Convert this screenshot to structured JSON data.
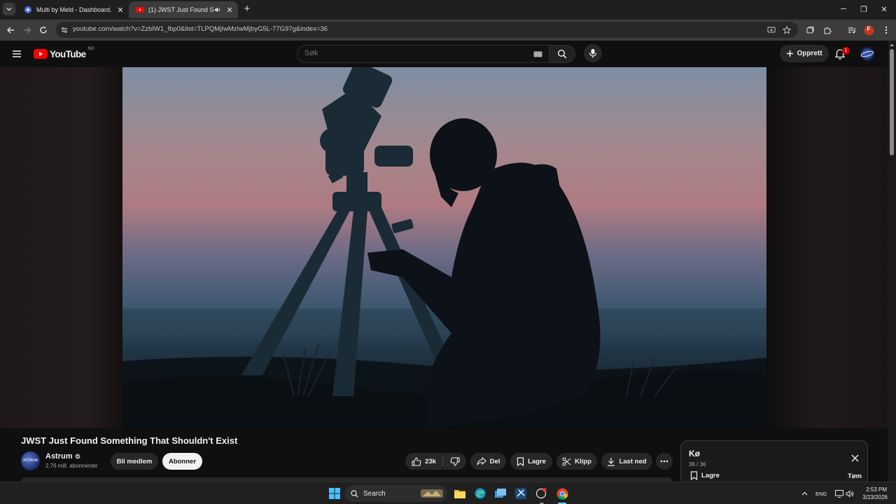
{
  "browser": {
    "tabs": [
      {
        "title": "Multi by Meld - Dashboard.",
        "active": false
      },
      {
        "title": "(1) JWST Just Found Someth",
        "active": true
      }
    ],
    "url": "youtube.com/watch?v=ZzbIW1_fbp0&list=TLPQMjIwMzIwMjbyG5L-77G97g&index=36",
    "profile_initial": "F"
  },
  "youtube": {
    "logo_text": "YouTube",
    "region": "NO",
    "search_placeholder": "Søk",
    "create_label": "Opprett",
    "notification_count": "1"
  },
  "video": {
    "title": "JWST Just Found Something That Shouldn't Exist",
    "channel": {
      "name": "Astrum",
      "subscribers": "2,76 mill. abonnenter",
      "avatar_text": "ASTRUM"
    },
    "actions": {
      "join": "Bli medlem",
      "subscribe": "Abonner",
      "likes": "23k",
      "share": "Del",
      "save": "Lagre",
      "clip": "Klipp",
      "download": "Last ned"
    }
  },
  "queue": {
    "title": "Kø",
    "position": "36 / 36",
    "save_label": "Lagre",
    "clear_label": "Tøm"
  },
  "taskbar": {
    "search_label": "Search",
    "language": "ENG",
    "time": "2:53 PM",
    "date": "3/23/2026"
  },
  "colors": {
    "youtube_red": "#ff0000",
    "background": "#0f0f0f",
    "chip": "#272727",
    "notification": "#cc0000"
  }
}
